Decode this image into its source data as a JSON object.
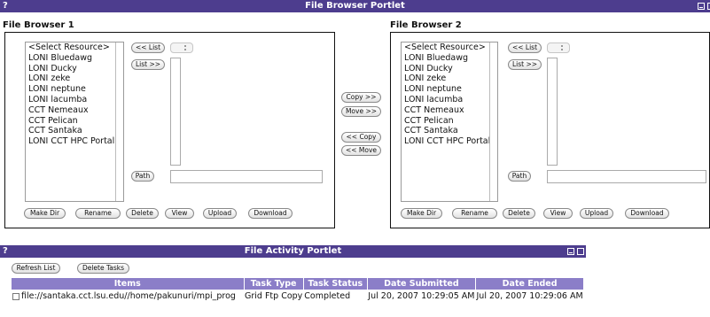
{
  "file_browser_portlet": {
    "help_glyph": "?",
    "title": "File Browser Portlet",
    "browser1": {
      "heading": "File Browser 1",
      "resources": [
        "<Select Resource>",
        "LONI Bluedawg",
        "LONI Ducky",
        "LONI zeke",
        "LONI neptune",
        "LONI lacumba",
        "CCT Nemeaux",
        "CCT Pelican",
        "CCT Santaka",
        "LONI CCT HPC Portal"
      ],
      "list_back_label": "<< List",
      "list_fwd_label": "List >>",
      "path_label": "Path",
      "path_value": "",
      "actions": [
        "Make Dir",
        "Rename",
        "Delete",
        "View",
        "Upload",
        "Download"
      ]
    },
    "browser2": {
      "heading": "File Browser 2",
      "resources": [
        "<Select Resource>",
        "LONI Bluedawg",
        "LONI Ducky",
        "LONI zeke",
        "LONI neptune",
        "LONI lacumba",
        "CCT Nemeaux",
        "CCT Pelican",
        "CCT Santaka",
        "LONI CCT HPC Portal"
      ],
      "list_back_label": "<< List",
      "list_fwd_label": "List >>",
      "path_label": "Path",
      "path_value": "",
      "actions": [
        "Make Dir",
        "Rename",
        "Delete",
        "View",
        "Upload",
        "Download"
      ]
    },
    "transfer": {
      "copy_right": "Copy >>",
      "move_right": "Move >>",
      "copy_left": "<< Copy",
      "move_left": "<< Move"
    }
  },
  "file_activity_portlet": {
    "help_glyph": "?",
    "title": "File Activity Portlet",
    "refresh_label": "Refresh List",
    "delete_tasks_label": "Delete Tasks",
    "columns": [
      "Items",
      "Task Type",
      "Task Status",
      "Date Submitted",
      "Date Ended"
    ],
    "rows": [
      {
        "item": "file://santaka.cct.lsu.edu//home/pakunuri/mpi_prog",
        "task_type": "Grid Ftp Copy",
        "task_status": "Completed",
        "date_submitted": "Jul 20, 2007 10:29:05 AM",
        "date_ended": "Jul 20, 2007 10:29:06 AM"
      }
    ]
  },
  "colors": {
    "title_bar": "#4d3d8e",
    "table_header": "#8b7ec8"
  }
}
